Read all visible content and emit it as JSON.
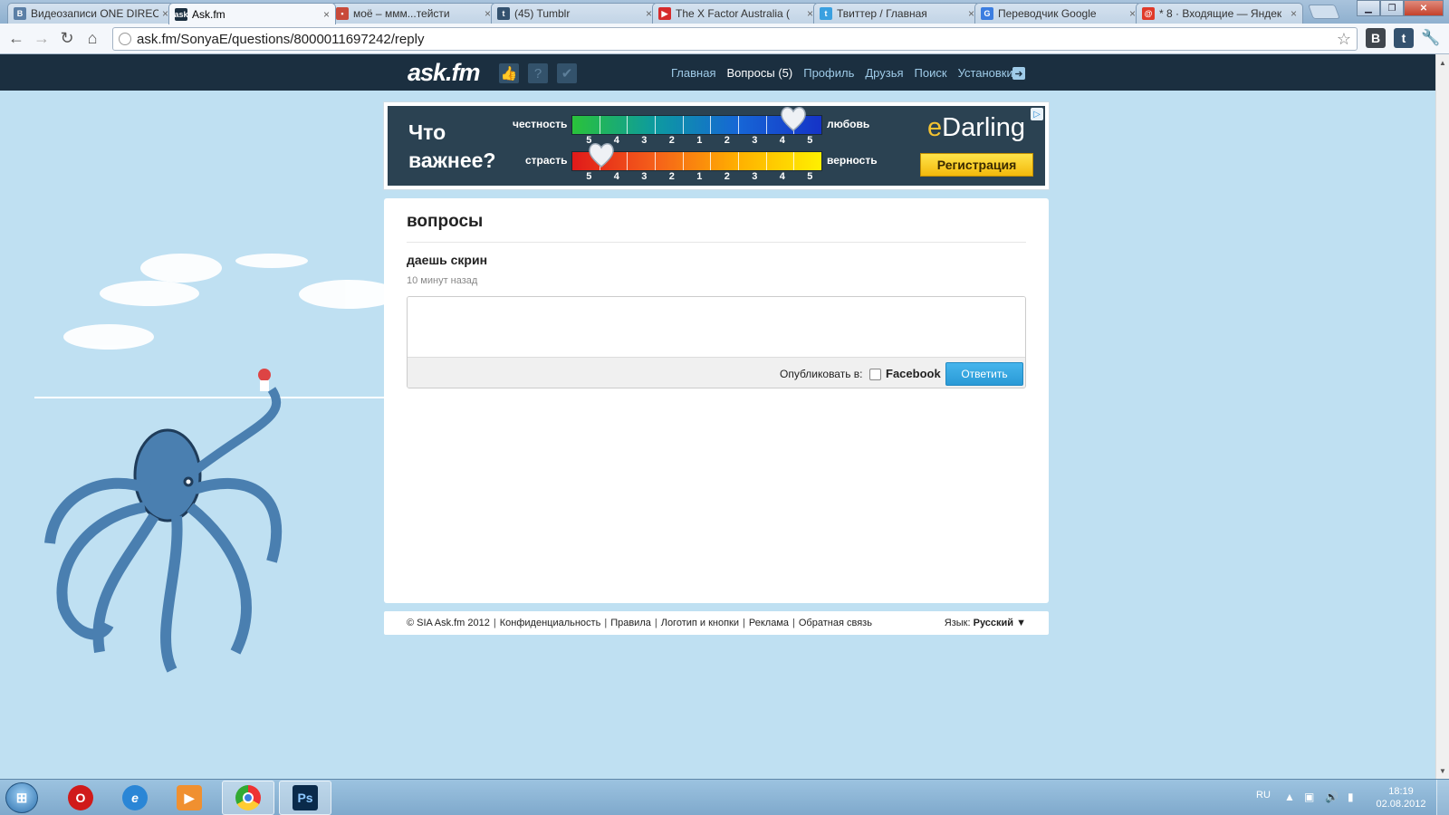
{
  "browser": {
    "tabs": [
      {
        "title": "Видеозаписи ONE DIREC",
        "icon": "vk-icon",
        "color": "#5b7fa6",
        "glyph": "В"
      },
      {
        "title": "Ask.fm",
        "icon": "askfm-icon",
        "color": "#1b2f40",
        "glyph": "ask",
        "active": true
      },
      {
        "title": "моё – ммм...тейсти",
        "icon": "mosaic-icon",
        "color": "#c84a3a",
        "glyph": "▪"
      },
      {
        "title": "(45) Tumblr",
        "icon": "tumblr-icon",
        "color": "#34526f",
        "glyph": "t"
      },
      {
        "title": "The X Factor Australia (",
        "icon": "youtube-icon",
        "color": "#d62b2b",
        "glyph": "▶"
      },
      {
        "title": "Твиттер / Главная",
        "icon": "twitter-icon",
        "color": "#3aa0e0",
        "glyph": "t"
      },
      {
        "title": "Переводчик Google",
        "icon": "google-translate-icon",
        "color": "#3b7de0",
        "glyph": "G"
      },
      {
        "title": "* 8 · Входящие — Яндек",
        "icon": "yandex-mail-icon",
        "color": "#e03a2a",
        "glyph": "@"
      }
    ],
    "url": "ask.fm/SonyaE/questions/8000011697242/reply",
    "window_buttons": [
      "▁",
      "❐",
      "✕"
    ]
  },
  "site": {
    "logo": "ask.fm",
    "nav": [
      {
        "label": "Главная",
        "current": false
      },
      {
        "label": "Вопросы (5)",
        "current": true
      },
      {
        "label": "Профиль",
        "current": false
      },
      {
        "label": "Друзья",
        "current": false
      },
      {
        "label": "Поиск",
        "current": false
      },
      {
        "label": "Установки",
        "current": false
      }
    ]
  },
  "ad": {
    "question_line1": "Что",
    "question_line2": "важнее?",
    "row1_left": "честность",
    "row1_right": "любовь",
    "row2_left": "страсть",
    "row2_right": "верность",
    "scale_numbers": [
      "5",
      "4",
      "3",
      "2",
      "1",
      "2",
      "3",
      "4",
      "5"
    ],
    "brand_e": "e",
    "brand_rest": "Darling",
    "cta": "Регистрация",
    "choice_icon": "▷"
  },
  "main": {
    "title": "вопросы",
    "question": "даешь скрин",
    "time": "10 минут назад",
    "answer_value": "",
    "publish_label": "Опубликовать в:",
    "facebook_label": "Facebook",
    "reply_button": "Ответить"
  },
  "footer": {
    "links": [
      "© SIA Ask.fm 2012",
      "Конфиденциальность",
      "Правила",
      "Логотип и кнопки",
      "Реклама",
      "Обратная связь"
    ],
    "lang_label": "Язык:",
    "lang_value": "Русский ▼"
  },
  "taskbar": {
    "lang": "RU",
    "time": "18:19",
    "date": "02.08.2012"
  }
}
